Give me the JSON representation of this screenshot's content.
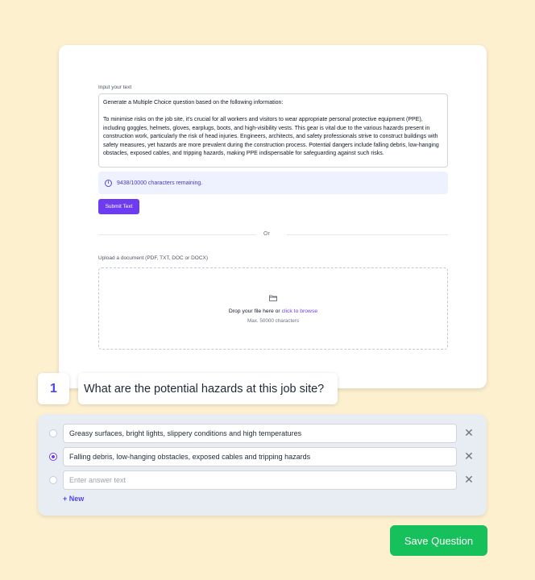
{
  "card": {
    "input_label": "Input your text",
    "text": "Generate a Multiple Choice question based on the following information:\n\nTo minimise risks on the job site, it's crucial for all workers and visitors to wear appropriate personal protective equipment (PPE), including goggles, helmets, gloves, earplugs, boots, and high-visibility vests. This gear is vital due to the various hazards present in construction work, particularly the risk of head injuries. Engineers, architects, and safety professionals strive to construct buildings with safety measures, yet hazards are more prevalent during the construction process. Potential dangers include falling debris, low-hanging obstacles, exposed cables, and tripping hazards, making PPE indispensable for safeguarding against such risks.",
    "chars_remaining": "9438/10000 characters remaining.",
    "submit_label": "Submit Text",
    "or_label": "Or",
    "upload_label": "Upload a document (PDF, TXT, DOC or DOCX)",
    "drop_text": "Drop your file here or ",
    "browse_text": "click to browse",
    "max_text": "Max. 50000 characters"
  },
  "question": {
    "number": "1",
    "title": "What are the potential hazards at this job site?"
  },
  "answers": [
    {
      "value": "Greasy surfaces, bright lights, slippery conditions and high temperatures",
      "checked": false
    },
    {
      "value": "Falling debris, low-hanging obstacles, exposed cables and tripping hazards",
      "checked": true
    },
    {
      "value": "",
      "placeholder": "Enter answer text",
      "checked": false
    }
  ],
  "new_label": "+ New",
  "save_label": "Save Question",
  "colors": {
    "accent": "#6d3cf0",
    "save": "#16c05a",
    "background": "#fdf0cf"
  }
}
